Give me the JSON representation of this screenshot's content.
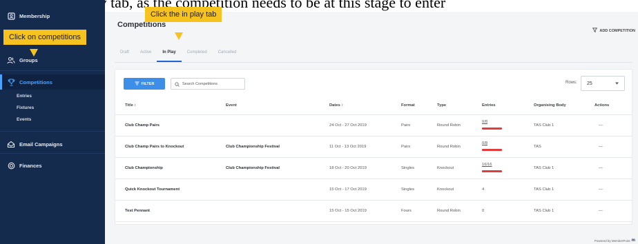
{
  "caption": "Select the In Play tab, as the competition needs to be at this stage to enter",
  "tooltips": {
    "competitions": "Click on competitions",
    "in_play": "Click the in play tab"
  },
  "sidebar": {
    "items": [
      {
        "label": "Membership",
        "icon": "membership-icon"
      },
      {
        "label": "Groups",
        "icon": "groups-icon"
      },
      {
        "label": "Competitions",
        "icon": "trophy-icon"
      },
      {
        "label": "Email Campaigns",
        "icon": "email-icon"
      },
      {
        "label": "Finances",
        "icon": "finances-icon"
      }
    ],
    "sub_items": [
      "Entries",
      "Fixtures",
      "Events"
    ]
  },
  "page": {
    "title": "Competitions",
    "add_button": "ADD COMPETITION"
  },
  "tabs": [
    "Draft",
    "Active",
    "In Play",
    "Completed",
    "Cancelled"
  ],
  "active_tab": "In Play",
  "toolbar": {
    "filter_label": "FILTER",
    "search_placeholder": "Search Competitions",
    "rows_label": "Rows:",
    "rows_value": "25"
  },
  "table": {
    "columns": [
      "Title",
      "Event",
      "Dates",
      "Format",
      "Type",
      "Entries",
      "Organising Body",
      "Actions"
    ],
    "rows": [
      {
        "title": "Club Champ Pairs",
        "event": "",
        "dates": "24 Oct - 27 Oct 2019",
        "format": "Pairs",
        "type": "Round Robin",
        "entries": "0/8",
        "entries_bar": true,
        "body": "TAS Club 1",
        "actions": "—"
      },
      {
        "title": "Club Champ Pairs to Knockout",
        "event": "Club Championship Festival",
        "dates": "11 Oct - 13 Oct 2019",
        "format": "Pairs",
        "type": "Round Robin",
        "entries": "0/8",
        "entries_bar": true,
        "body": "TAS",
        "actions": "—"
      },
      {
        "title": "Club Championship",
        "event": "Club Championship Festival",
        "dates": "18 Oct - 20 Oct 2019",
        "format": "Singles",
        "type": "Knockout",
        "entries": "16/16",
        "entries_bar": true,
        "body": "TAS Club 1",
        "actions": "—"
      },
      {
        "title": "Quick Knockout Tournament",
        "event": "",
        "dates": "15 Oct - 17 Oct 2019",
        "format": "Singles",
        "type": "Knockout",
        "entries": "4",
        "entries_bar": false,
        "body": "TAS Club 1",
        "actions": "—"
      },
      {
        "title": "Test Pennant",
        "event": "",
        "dates": "15 Oct - 15 Oct 2019",
        "format": "Fours",
        "type": "Round Robin",
        "entries": "0",
        "entries_bar": false,
        "body": "TAS Club 1",
        "actions": "—"
      }
    ]
  },
  "footer": {
    "powered_by": "Powered by MemberPoint",
    "logo": "m"
  },
  "colors": {
    "sidebar": "#152b4e",
    "accent": "#3d8ee8",
    "tooltip": "#f6c21d",
    "entries_bar": "#e23b3b"
  }
}
